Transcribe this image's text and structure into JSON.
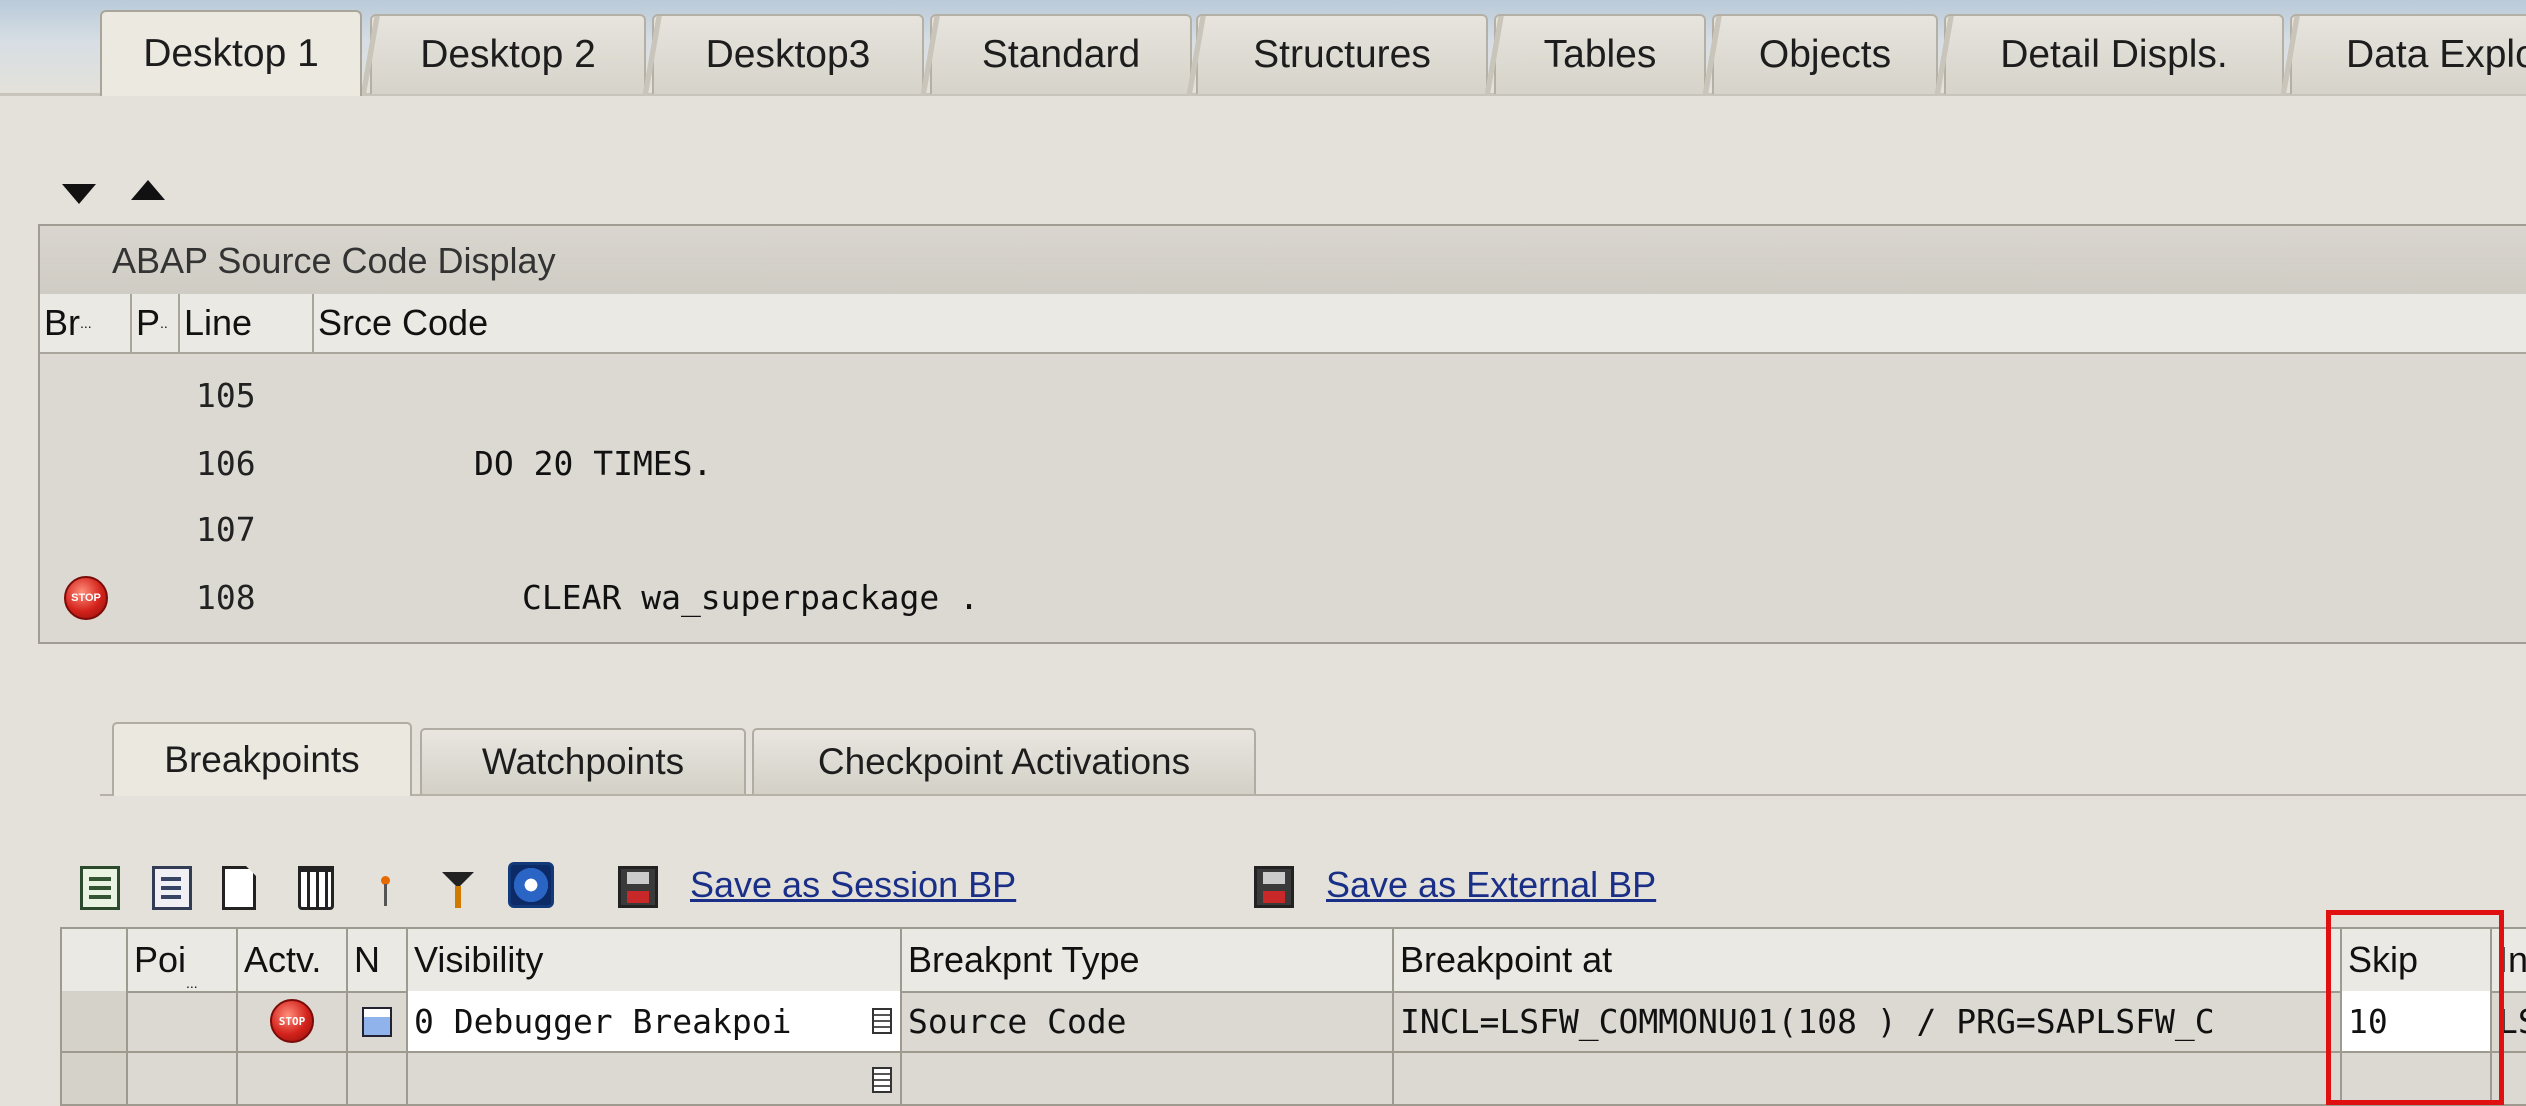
{
  "desktop_tabs": [
    "Desktop 1",
    "Desktop 2",
    "Desktop3",
    "Standard",
    "Structures",
    "Tables",
    "Objects",
    "Detail Displs.",
    "Data Explo"
  ],
  "active_desktop_tab": "Desktop 1",
  "source_panel": {
    "title": "ABAP Source Code Display",
    "columns": {
      "br": "Br",
      "p": "P",
      "line": "Line",
      "code": "Srce Code"
    },
    "lines": [
      {
        "line": "105",
        "code": ""
      },
      {
        "line": "106",
        "code": "DO 20 TIMES."
      },
      {
        "line": "107",
        "code": ""
      },
      {
        "line": "108",
        "code": "CLEAR wa_superpackage ."
      }
    ]
  },
  "bottom_tabs": [
    "Breakpoints",
    "Watchpoints",
    "Checkpoint Activations"
  ],
  "active_bottom_tab": "Breakpoints",
  "toolbar": {
    "save_session_bp": "Save as Session BP",
    "save_external_bp": "Save as External BP"
  },
  "breakpoint_table": {
    "columns": {
      "poi": "Poi",
      "actv": "Actv.",
      "n": "N",
      "visibility": "Visibility",
      "type": "Breakpnt Type",
      "at": "Breakpoint at",
      "skip": "Skip",
      "next": "In"
    },
    "rows": [
      {
        "visibility": "0 Debugger Breakpoi",
        "type": "Source Code",
        "at": "INCL=LSFW_COMMONU01(108 ) / PRG=SAPLSFW_C",
        "skip": "10",
        "next": "LS"
      }
    ]
  },
  "colors": {
    "highlight": "#e01010",
    "link": "#1a2f87",
    "stop": "#d3221b"
  }
}
